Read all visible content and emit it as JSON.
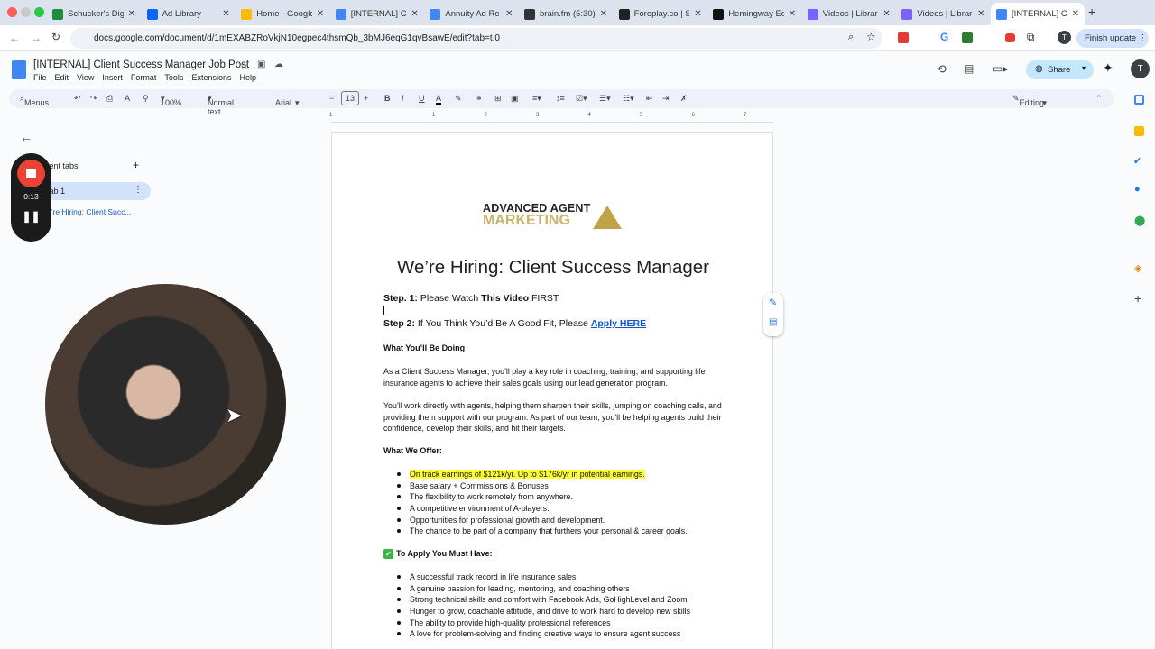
{
  "browser": {
    "tabs": [
      {
        "title": "Schucker's Dig",
        "color": "#1e8e3e"
      },
      {
        "title": "Ad Library",
        "color": "#0866ff"
      },
      {
        "title": "Home - Google",
        "color": "#fbbc04"
      },
      {
        "title": "[INTERNAL] Cl",
        "color": "#4285f4"
      },
      {
        "title": "Annuity Ad Re",
        "color": "#4285f4"
      },
      {
        "title": "brain.fm (5:30)",
        "color": "#333333"
      },
      {
        "title": "Foreplay.co | S",
        "color": "#222222"
      },
      {
        "title": "Hemingway Ed",
        "color": "#111111"
      },
      {
        "title": "Videos | Librar",
        "color": "#7b61ff"
      },
      {
        "title": "Videos | Librar",
        "color": "#7b61ff"
      },
      {
        "title": "[INTERNAL] Cl",
        "color": "#4285f4"
      }
    ],
    "url": "docs.google.com/document/d/1mEXABZRoVkjN10egpec4thsmQb_3bMJ6eqG1qvBsawE/edit?tab=t.0",
    "finish_update": "Finish update",
    "profile_initial": "T"
  },
  "docs": {
    "title": "[INTERNAL] Client Success Manager Job Post",
    "menu": [
      "File",
      "Edit",
      "View",
      "Insert",
      "Format",
      "Tools",
      "Extensions",
      "Help"
    ],
    "share": "Share",
    "toolbar": {
      "menus": "Menus",
      "zoom": "100%",
      "style": "Normal text",
      "font": "Arial",
      "size": "13",
      "mode": "Editing"
    },
    "ruler": [
      "1",
      "1",
      "2",
      "3",
      "4",
      "5",
      "6",
      "7"
    ]
  },
  "sidebar": {
    "header": "Document tabs",
    "tab": "Tab 1",
    "outline": "We’re Hiring: Client Succ..."
  },
  "recorder": {
    "time": "0:13"
  },
  "document": {
    "logo": {
      "line1": "ADVANCED AGENT",
      "line2": "MARKETING"
    },
    "heading": "We’re Hiring: Client Success Manager",
    "step1": {
      "label": "Step. 1:",
      "text1": " Please Watch ",
      "bold": "This Video",
      "text2": " FIRST"
    },
    "step2": {
      "label": "Step 2:",
      "text": " If You Think You’d Be A Good Fit, Please ",
      "link": "Apply HERE"
    },
    "doing_heading": "What You’ll Be Doing",
    "para1": "As a Client Success Manager, you’ll play a key role in coaching, training, and supporting life insurance agents to achieve their sales goals using our lead generation program.",
    "para2": "You’ll work directly with agents, helping them sharpen their skills, jumping on coaching calls, and providing them support with our program. As part of our team, you’ll be helping agents build their confidence, develop their skills, and hit their targets.",
    "offer_heading": "What We Offer:",
    "offer": [
      "On track earnings of $121k/yr. Up to $176k/yr in potential earnings.",
      "Base salary + Commissions & Bonuses",
      "The flexibility to work remotely from anywhere.",
      "A competitive environment of A-players.",
      "Opportunities for professional growth and development.",
      "The chance to be part of a company that furthers your personal & career goals."
    ],
    "must_heading": "To Apply You Must Have:",
    "must": [
      "A successful track record in life insurance sales",
      "A genuine passion for leading, mentoring, and coaching others",
      "Strong technical skills and comfort with Facebook Ads, GoHighLevel and Zoom",
      "Hunger to grow, coachable attitude, and drive to work hard to develop new skills",
      "The ability to provide high-quality professional references",
      "A love for problem-solving and finding creative ways to ensure agent success"
    ]
  }
}
